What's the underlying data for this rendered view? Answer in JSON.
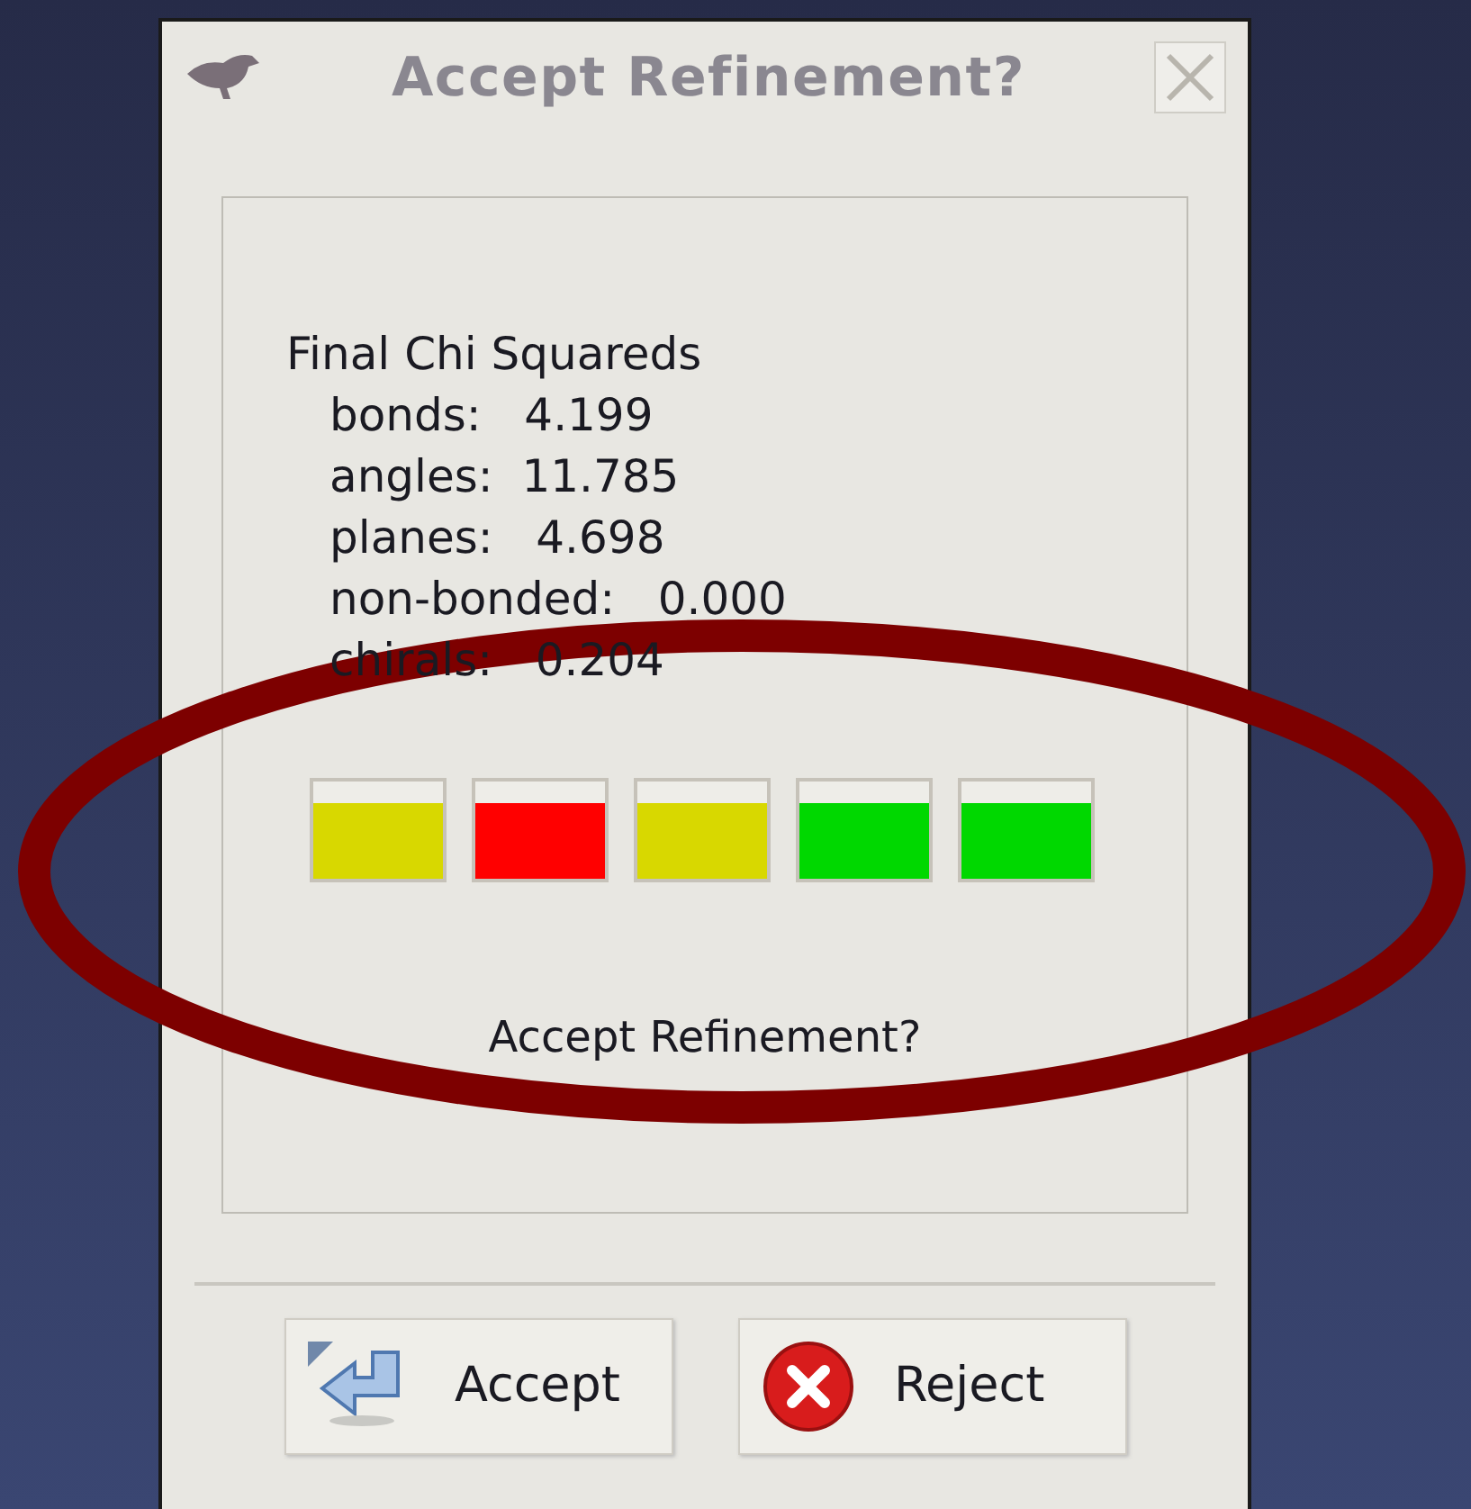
{
  "window": {
    "title": "Accept Refinement?"
  },
  "summary": {
    "heading": "Final Chi Squareds",
    "lines": [
      "bonds:   4.199",
      "angles:  11.785",
      "planes:   4.698",
      "non-bonded:   0.000",
      "chirals:   0.204"
    ]
  },
  "bars": [
    {
      "color": "#d8d800"
    },
    {
      "color": "#ff0000"
    },
    {
      "color": "#d8d800"
    },
    {
      "color": "#00d800"
    },
    {
      "color": "#00d800"
    }
  ],
  "question": "Accept Refinement?",
  "buttons": [
    {
      "kind": "accept",
      "label": "Accept"
    },
    {
      "kind": "reject",
      "label": "Reject"
    }
  ]
}
